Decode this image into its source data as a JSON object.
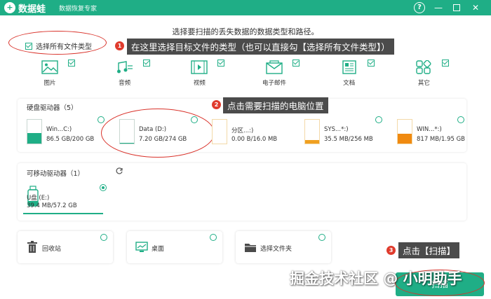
{
  "titlebar": {
    "logo_glyph": "+",
    "app_name": "数据蛙",
    "app_subtitle": "数据恢复专家",
    "help_glyph": "?",
    "min_glyph": "—",
    "close_glyph": "✕",
    "bg_color": "#1fae86"
  },
  "prompt": "选择要扫描的丢失数据的数据类型和路径。",
  "select_all": {
    "label": "选择所有文件类型",
    "checked": true
  },
  "annotations": [
    {
      "badge": "1",
      "text": "在这里选择目标文件的类型（也可以直接勾【选择所有文件类型】）"
    },
    {
      "badge": "2",
      "text": "点击需要扫描的电脑位置"
    },
    {
      "badge": "3",
      "text": "点击【扫描】"
    }
  ],
  "file_types": [
    {
      "label": "图片",
      "icon": "image-icon",
      "checked": true
    },
    {
      "label": "音频",
      "icon": "audio-icon",
      "checked": true
    },
    {
      "label": "视频",
      "icon": "video-icon",
      "checked": true
    },
    {
      "label": "电子邮件",
      "icon": "email-icon",
      "checked": true
    },
    {
      "label": "文档",
      "icon": "document-icon",
      "checked": true
    },
    {
      "label": "其它",
      "icon": "other-icon",
      "checked": true
    }
  ],
  "hard_drives": {
    "title": "硬盘驱动器（5）",
    "items": [
      {
        "name": "Win...C:)",
        "size": "86.5 GB/200 GB",
        "fill_color": "#1fae86",
        "used_fraction": 0.43,
        "selected": false
      },
      {
        "name": "Data (D:)",
        "size": "7.20 GB/274 GB",
        "fill_color": "#1fae86",
        "used_fraction": 0.03,
        "selected": false
      },
      {
        "name": "分区...:)",
        "size": "0.00  B/16.0 MB",
        "fill_color": "#f0a020",
        "used_fraction": 0.0,
        "selected": false
      },
      {
        "name": "SYS...*:)",
        "size": "35.5 MB/256 MB",
        "fill_color": "#f0a020",
        "used_fraction": 0.14,
        "selected": false
      },
      {
        "name": "WIN...*:)",
        "size": "817 MB/1.95 GB",
        "fill_color": "#f08a10",
        "used_fraction": 0.42,
        "selected": false
      }
    ]
  },
  "removable": {
    "title": "可移动驱动器（1）",
    "refresh_icon": "refresh-icon",
    "items": [
      {
        "name": "U盘 (E:)",
        "size": "39.4 MB/57.2 GB",
        "selected": true
      }
    ]
  },
  "locations": [
    {
      "label": "回收站",
      "icon": "recycle-bin-icon"
    },
    {
      "label": "桌面",
      "icon": "desktop-icon"
    },
    {
      "label": "选择文件夹",
      "icon": "folder-icon"
    }
  ],
  "scan_button": {
    "label": "扫描"
  },
  "watermark": "掘金技术社区 @ 小明助手"
}
